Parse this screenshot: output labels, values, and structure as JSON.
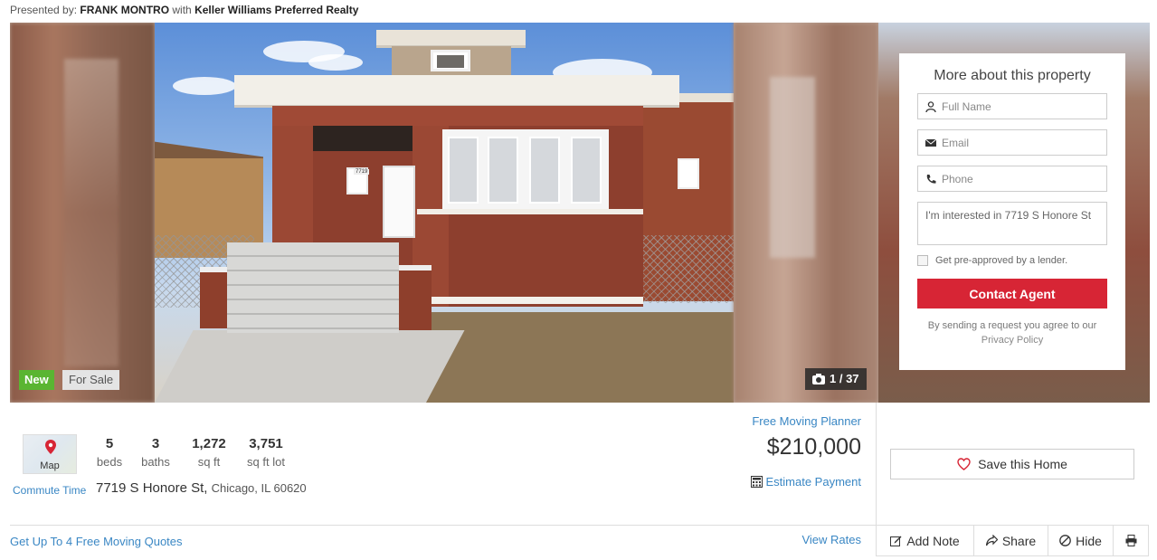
{
  "header": {
    "presented_prefix": "Presented by:",
    "agent_name": "FRANK MONTRO",
    "with": "with",
    "brokerage": "Keller Williams Preferred Realty"
  },
  "gallery": {
    "badge_new": "New",
    "badge_status": "For Sale",
    "photo_counter": "1 / 37",
    "house_number_plate": "7719"
  },
  "contact_form": {
    "title": "More about this property",
    "name_placeholder": "Full Name",
    "email_placeholder": "Email",
    "phone_placeholder": "Phone",
    "message_value": "I'm interested in 7719 S Honore St",
    "lender_checkbox_label": "Get pre-approved by a lender.",
    "submit_label": "Contact Agent",
    "disclaimer": "By sending a request you agree to our",
    "privacy_link": "Privacy Policy"
  },
  "listing": {
    "map_label": "Map",
    "commute_link": "Commute Time",
    "stats": [
      {
        "value": "5",
        "label": "beds"
      },
      {
        "value": "3",
        "label": "baths"
      },
      {
        "value": "1,272",
        "label": "sq ft"
      },
      {
        "value": "3,751",
        "label": "sq ft lot"
      }
    ],
    "street": "7719 S Honore St,",
    "city_state_zip": "Chicago, IL 60620",
    "moving_planner_link": "Free Moving Planner",
    "price": "$210,000",
    "estimate_payment_link": "Estimate Payment",
    "moving_quotes_link": "Get Up To 4 Free Moving Quotes",
    "view_rates_link": "View Rates"
  },
  "actions": {
    "save_label": "Save this Home",
    "add_note_label": "Add Note",
    "share_label": "Share",
    "hide_label": "Hide"
  },
  "colors": {
    "accent_link": "#3a87c4",
    "contact_button": "#d72535",
    "new_badge": "#5ab532"
  }
}
